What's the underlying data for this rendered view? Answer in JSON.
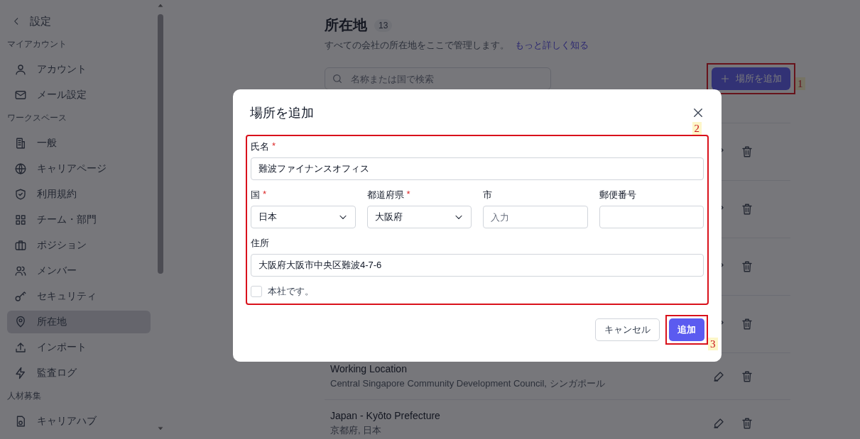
{
  "sidebar": {
    "back_label": "設定",
    "sections": [
      {
        "heading": "マイアカウント",
        "items": [
          {
            "label": "アカウント",
            "selected": false
          },
          {
            "label": "メール設定",
            "selected": false
          }
        ]
      },
      {
        "heading": "ワークスペース",
        "items": [
          {
            "label": "一般",
            "selected": false
          },
          {
            "label": "キャリアページ",
            "selected": false
          },
          {
            "label": "利用規約",
            "selected": false
          },
          {
            "label": "チーム・部門",
            "selected": false
          },
          {
            "label": "ポジション",
            "selected": false
          },
          {
            "label": "メンバー",
            "selected": false
          },
          {
            "label": "セキュリティ",
            "selected": false
          },
          {
            "label": "所在地",
            "selected": true
          },
          {
            "label": "インポート",
            "selected": false
          },
          {
            "label": "監査ログ",
            "selected": false
          }
        ]
      },
      {
        "heading": "人材募集",
        "items": [
          {
            "label": "キャリアハブ",
            "selected": false
          }
        ]
      }
    ]
  },
  "page": {
    "title": "所在地",
    "count": "13",
    "description": "すべての会社の所在地をここで管理します。",
    "learn_more_link": "もっと詳しく知る",
    "search": {
      "placeholder": "名称または国で検索"
    },
    "add_button": "場所を追加",
    "locations": [
      {
        "kind": "covered"
      },
      {
        "kind": "covered"
      },
      {
        "kind": "covered"
      },
      {
        "kind": "covered"
      },
      {
        "kind": "full",
        "title": "Working Location",
        "subtitle": "Central Singapore Community Development Council, シンガポール"
      },
      {
        "kind": "full",
        "title": "Japan - Kyōto Prefecture",
        "subtitle": "京都府, 日本"
      }
    ]
  },
  "dialog": {
    "title": "場所を追加",
    "field_rows": [
      [
        {
          "kind": "text",
          "label": "氏名",
          "required_mark": "*",
          "value": "難波ファイナンスオフィス"
        }
      ],
      [
        {
          "kind": "select",
          "label": "国",
          "required_mark": "*",
          "value": "日本"
        },
        {
          "kind": "select",
          "label": "都道府県",
          "required_mark": "*",
          "value": "大阪府"
        },
        {
          "kind": "text",
          "label": "市",
          "placeholder": "入力"
        },
        {
          "kind": "text",
          "label": "郵便番号"
        }
      ],
      [
        {
          "kind": "text",
          "label": "住所",
          "value": "大阪府大阪市中央区難波4-7-6"
        }
      ]
    ],
    "checkbox": {
      "label": "本社です。",
      "checked": false
    },
    "buttons": [
      {
        "kind": "secondary",
        "label": "キャンセル"
      },
      {
        "kind": "primary",
        "label": "追加"
      }
    ]
  },
  "annotations": [
    {
      "label": "1"
    },
    {
      "label": "2"
    },
    {
      "label": "3"
    }
  ]
}
